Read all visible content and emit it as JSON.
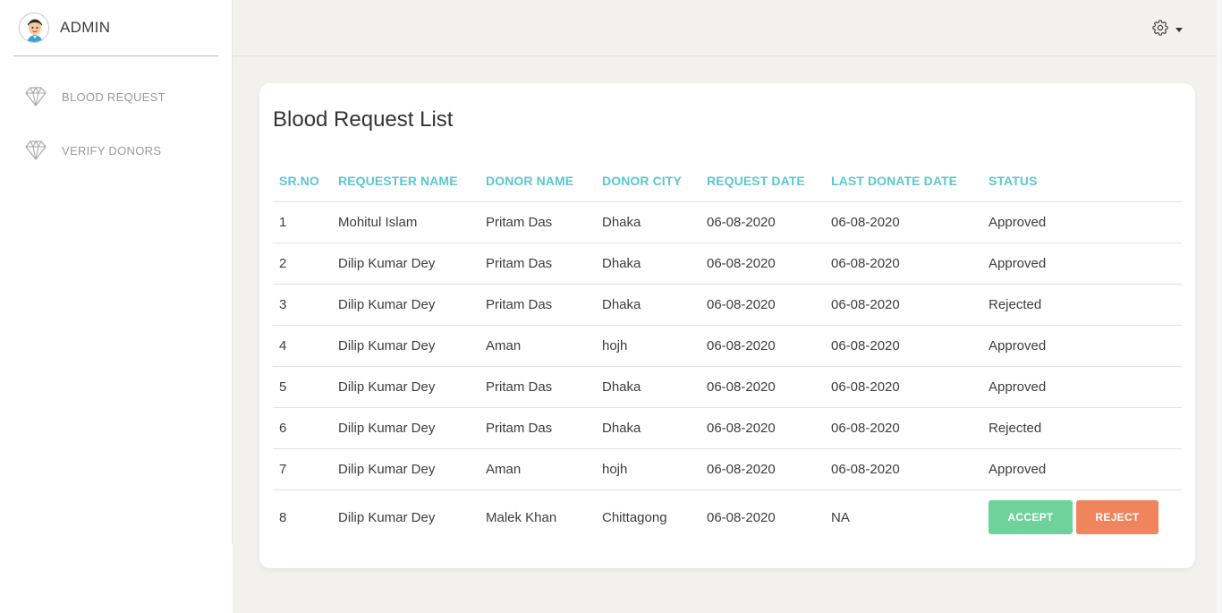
{
  "brand": {
    "name": "ADMIN",
    "avatar_icon": "user-avatar-icon"
  },
  "sidebar": {
    "items": [
      {
        "label": "BLOOD REQUEST",
        "icon": "diamond-icon"
      },
      {
        "label": "VERIFY DONORS",
        "icon": "diamond-icon"
      }
    ]
  },
  "topbar": {
    "settings_icon": "gear-icon",
    "dropdown_icon": "caret-down-icon"
  },
  "page": {
    "title": "Blood Request List"
  },
  "table": {
    "headers": [
      "SR.NO",
      "REQUESTER NAME",
      "DONOR NAME",
      "DONOR CITY",
      "REQUEST DATE",
      "LAST DONATE DATE",
      "STATUS"
    ],
    "rows": [
      {
        "sr": "1",
        "requester": "Mohitul Islam",
        "donor": "Pritam Das",
        "city": "Dhaka",
        "request_date": "06-08-2020",
        "last_donate": "06-08-2020",
        "status": "Approved"
      },
      {
        "sr": "2",
        "requester": "Dilip Kumar Dey",
        "donor": "Pritam Das",
        "city": "Dhaka",
        "request_date": "06-08-2020",
        "last_donate": "06-08-2020",
        "status": "Approved"
      },
      {
        "sr": "3",
        "requester": "Dilip Kumar Dey",
        "donor": "Pritam Das",
        "city": "Dhaka",
        "request_date": "06-08-2020",
        "last_donate": "06-08-2020",
        "status": "Rejected"
      },
      {
        "sr": "4",
        "requester": "Dilip Kumar Dey",
        "donor": "Aman",
        "city": "hojh",
        "request_date": "06-08-2020",
        "last_donate": "06-08-2020",
        "status": "Approved"
      },
      {
        "sr": "5",
        "requester": "Dilip Kumar Dey",
        "donor": "Pritam Das",
        "city": "Dhaka",
        "request_date": "06-08-2020",
        "last_donate": "06-08-2020",
        "status": "Approved"
      },
      {
        "sr": "6",
        "requester": "Dilip Kumar Dey",
        "donor": "Pritam Das",
        "city": "Dhaka",
        "request_date": "06-08-2020",
        "last_donate": "06-08-2020",
        "status": "Rejected"
      },
      {
        "sr": "7",
        "requester": "Dilip Kumar Dey",
        "donor": "Aman",
        "city": "hojh",
        "request_date": "06-08-2020",
        "last_donate": "06-08-2020",
        "status": "Approved"
      },
      {
        "sr": "8",
        "requester": "Dilip Kumar Dey",
        "donor": "Malek Khan",
        "city": "Chittagong",
        "request_date": "06-08-2020",
        "last_donate": "NA",
        "status": ""
      }
    ],
    "actions": {
      "accept_label": "ACCEPT",
      "reject_label": "REJECT"
    }
  },
  "colors": {
    "header_text": "#5bc7cf",
    "accept": "#6dd39a",
    "reject": "#f0845c",
    "background": "#f2f1ee"
  }
}
